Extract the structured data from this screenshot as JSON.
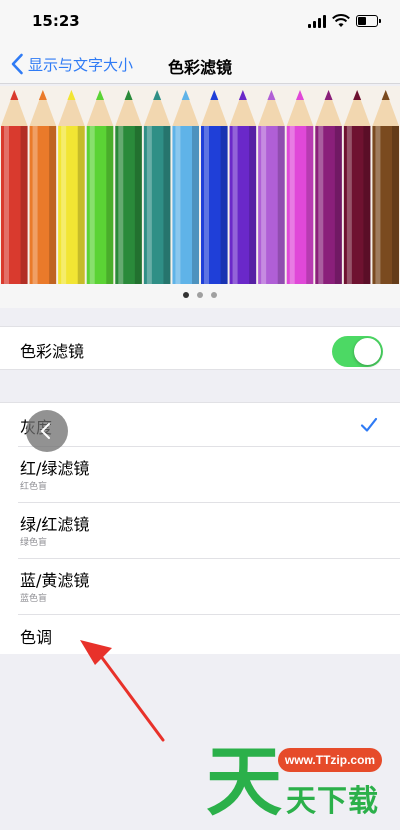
{
  "status_bar": {
    "time": "15:23"
  },
  "nav": {
    "back_label": "显示与文字大小",
    "title": "色彩滤镜"
  },
  "preview": {
    "pencil_colors": [
      "#d93a2e",
      "#ea7a2a",
      "#f2e533",
      "#5bd335",
      "#2a8a3a",
      "#2f8f86",
      "#5fb3e8",
      "#1f3fd8",
      "#6a28c9",
      "#b05fd6",
      "#e048d8",
      "#8a1f7a",
      "#6e1230",
      "#7a4a1f"
    ],
    "page_count": 3,
    "active_page": 1
  },
  "colors": {
    "accent": "#2f7bf5",
    "toggle_on": "#4cd964",
    "dot_active": "#333333",
    "dot_inactive": "#a0a0a0"
  },
  "toggle_row": {
    "label": "色彩滤镜",
    "enabled": true
  },
  "filters": [
    {
      "label": "灰度",
      "subtitle": "",
      "selected": true
    },
    {
      "label": "红/绿滤镜",
      "subtitle": "红色盲",
      "selected": false
    },
    {
      "label": "绿/红滤镜",
      "subtitle": "绿色盲",
      "selected": false
    },
    {
      "label": "蓝/黄滤镜",
      "subtitle": "蓝色盲",
      "selected": false
    },
    {
      "label": "色调",
      "subtitle": "",
      "selected": false
    }
  ],
  "watermark": {
    "url": "www.TTzip.com",
    "text": "天下载",
    "logo_char": "天"
  }
}
